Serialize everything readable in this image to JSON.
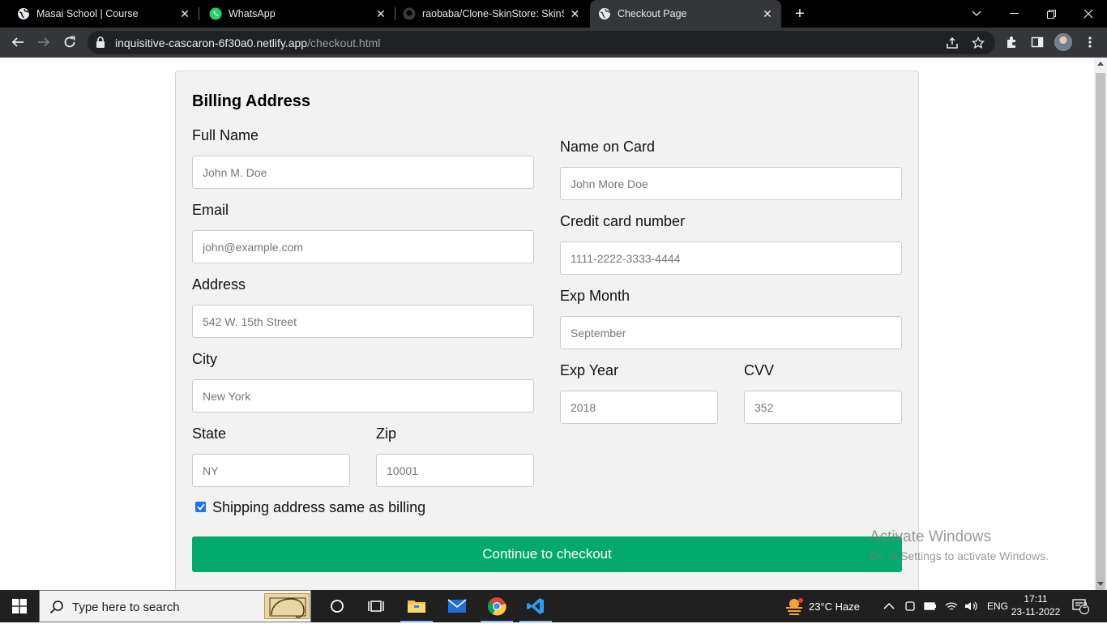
{
  "browser": {
    "tabs": [
      {
        "title": "Masai School | Course",
        "icon": "globe-icon",
        "active": false
      },
      {
        "title": "WhatsApp",
        "icon": "whatsapp-icon",
        "active": false
      },
      {
        "title": "raobaba/Clone-SkinStore: SkinSt",
        "icon": "github-icon",
        "active": false
      },
      {
        "title": "Checkout Page",
        "icon": "globe-icon",
        "active": true
      }
    ],
    "url_host": "inquisitive-cascaron-6f30a0.netlify.app",
    "url_path": "/checkout.html"
  },
  "form": {
    "heading": "Billing Address",
    "full_name": {
      "label": "Full Name",
      "placeholder": "John M. Doe"
    },
    "email": {
      "label": "Email",
      "placeholder": "john@example.com"
    },
    "address": {
      "label": "Address",
      "placeholder": "542 W. 15th Street"
    },
    "city": {
      "label": "City",
      "placeholder": "New York"
    },
    "state": {
      "label": "State",
      "placeholder": "NY"
    },
    "zip": {
      "label": "Zip",
      "placeholder": "10001"
    },
    "name_on_card": {
      "label": "Name on Card",
      "placeholder": "John More Doe"
    },
    "card_number": {
      "label": "Credit card number",
      "placeholder": "1111-2222-3333-4444"
    },
    "exp_month": {
      "label": "Exp Month",
      "placeholder": "September"
    },
    "exp_year": {
      "label": "Exp Year",
      "placeholder": "2018"
    },
    "cvv": {
      "label": "CVV",
      "placeholder": "352"
    },
    "same_address": {
      "label": "Shipping address same as billing",
      "checked": true
    },
    "submit_label": "Continue to checkout"
  },
  "watermark": {
    "line1": "Activate Windows",
    "line2": "Go to Settings to activate Windows."
  },
  "taskbar": {
    "search_placeholder": "Type here to search",
    "weather": "23°C  Haze",
    "language": "ENG",
    "time": "17:11",
    "date": "23-11-2022",
    "notification_count": "2"
  },
  "colors": {
    "submit_bg": "#04aa6d",
    "card_bg": "#f2f2f2",
    "checkbox": "#1a73e8"
  }
}
